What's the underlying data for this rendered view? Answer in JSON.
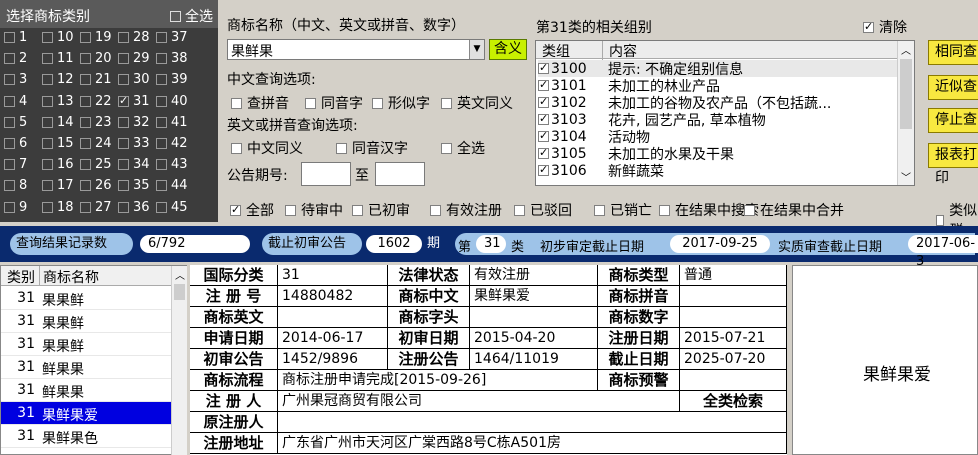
{
  "category_panel": {
    "title": "选择商标类别",
    "select_all": "全选",
    "columns": [
      [
        "1",
        "2",
        "3",
        "4",
        "5",
        "6",
        "7",
        "8",
        "9"
      ],
      [
        "10",
        "11",
        "12",
        "13",
        "14",
        "15",
        "16",
        "17",
        "18"
      ],
      [
        "19",
        "20",
        "21",
        "22",
        "23",
        "24",
        "25",
        "26",
        "27"
      ],
      [
        "28",
        "29",
        "30",
        "31",
        "32",
        "33",
        "34",
        "35",
        "36"
      ],
      [
        "37",
        "38",
        "39",
        "40",
        "41",
        "42",
        "43",
        "44",
        "45"
      ]
    ],
    "checked": "31"
  },
  "query": {
    "name_label": "商标名称（中文、英文或拼音、数字）",
    "name_value": "果鲜果",
    "meaning_button": "含义",
    "cn_options_label": "中文查询选项:",
    "cn_options": [
      "查拼音",
      "同音字",
      "形似字",
      "英文同义"
    ],
    "en_options_label": "英文或拼音查询选项:",
    "en_options": [
      "中文同义",
      "同音汉字",
      "全选"
    ],
    "announce_label": "公告期号:",
    "to_label": "至"
  },
  "groups": {
    "title": "第31类的相关组别",
    "clear_label": "清除",
    "header_code": "类组",
    "header_content": "内容",
    "rows": [
      {
        "code": "3100",
        "text": "提示: 不确定组别信息"
      },
      {
        "code": "3101",
        "text": "未加工的林业产品"
      },
      {
        "code": "3102",
        "text": "未加工的谷物及农产品（不包括蔬..."
      },
      {
        "code": "3103",
        "text": "花卉, 园艺产品, 草本植物"
      },
      {
        "code": "3104",
        "text": "活动物"
      },
      {
        "code": "3105",
        "text": "未加工的水果及干果"
      },
      {
        "code": "3106",
        "text": "新鲜蔬菜"
      }
    ]
  },
  "side_buttons": [
    "相同查",
    "近似查",
    "停止查",
    "报表打印"
  ],
  "filters": [
    "全部",
    "待审中",
    "已初审",
    "有效注册",
    "已驳回",
    "已销亡",
    "在结果中搜索",
    "在结果中合并",
    "类似群"
  ],
  "status": {
    "records_label": "查询结果记录数",
    "records_value": "6/792",
    "cutoff_label": "截止初审公告",
    "cutoff_value": "1602",
    "cutoff_unit": "期",
    "class_prefix": "第",
    "class_value": "31",
    "class_suffix": "类",
    "prelim_label": "初步审定截止日期",
    "prelim_value": "2017-09-25",
    "substantive_label": "实质审查截止日期",
    "substantive_value": "2017-06-3"
  },
  "results": {
    "header_class": "类别",
    "header_name": "商标名称",
    "rows": [
      {
        "cls": "31",
        "name": "果果鲜"
      },
      {
        "cls": "31",
        "name": "果果鲜"
      },
      {
        "cls": "31",
        "name": "果果鲜"
      },
      {
        "cls": "31",
        "name": "鲜果果"
      },
      {
        "cls": "31",
        "name": "鲜果果"
      },
      {
        "cls": "31",
        "name": "果鲜果爱"
      },
      {
        "cls": "31",
        "name": "果鲜果色"
      }
    ],
    "selected": 5
  },
  "detail": {
    "intl_class_label": "国际分类",
    "intl_class": "31",
    "legal_status_label": "法律状态",
    "legal_status": "有效注册",
    "mark_type_label": "商标类型",
    "mark_type": "普通",
    "reg_no_label": "注 册 号",
    "reg_no": "14880482",
    "mark_cn_label": "商标中文",
    "mark_cn": "果鲜果爱",
    "mark_pinyin_label": "商标拼音",
    "mark_pinyin": "",
    "mark_en_label": "商标英文",
    "mark_en": "",
    "mark_initial_label": "商标字头",
    "mark_initial": "",
    "mark_digit_label": "商标数字",
    "mark_digit": "",
    "apply_date_label": "申请日期",
    "apply_date": "2014-06-17",
    "prelim_date_label": "初审日期",
    "prelim_date": "2015-04-20",
    "reg_date_label": "注册日期",
    "reg_date": "2015-07-21",
    "prelim_no_label": "初审公告",
    "prelim_no": "1452/9896",
    "reg_notice_label": "注册公告",
    "reg_notice": "1464/11019",
    "expire_label": "截止日期",
    "expire": "2025-07-20",
    "flow_label": "商标流程",
    "flow": "商标注册申请完成[2015-09-26]",
    "warning_label": "商标预警",
    "warning": "",
    "registrant_label": "注 册 人",
    "registrant": "广州果冠商贸有限公司",
    "all_class_label": "全类检索",
    "orig_registrant_label": "原注册人",
    "orig_registrant": "",
    "address_label": "注册地址",
    "address": "广东省广州市天河区广棠西路8号C栋A501房"
  },
  "mark_image_text": "果鲜果爱"
}
